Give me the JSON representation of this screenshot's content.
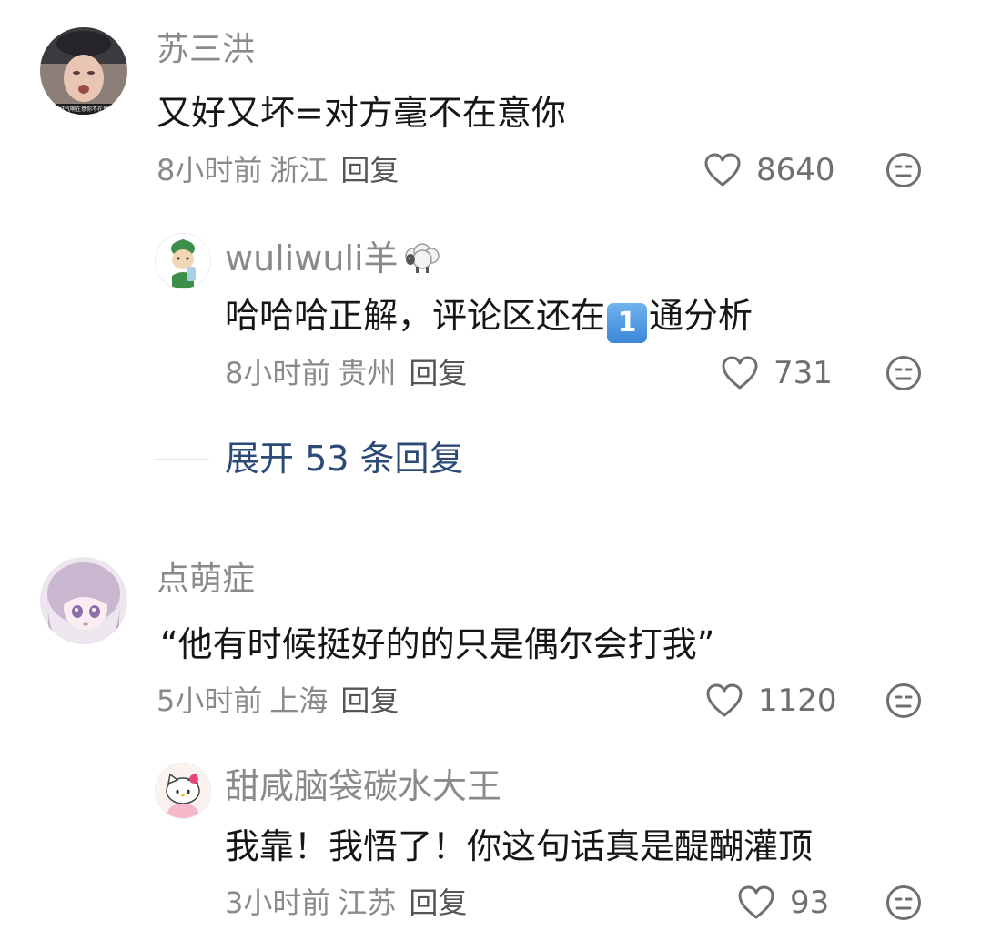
{
  "comments": [
    {
      "username": "苏三洪",
      "text": "又好又坏=对方毫不在意你",
      "time": "8小时前",
      "location": "浙江",
      "reply_label": "回复",
      "likes": "8640",
      "avatar_caption": "我好气啊在意你不在意你",
      "replies": [
        {
          "username": "wuliwuli羊",
          "username_emoji": "sheep",
          "text_before": "哈哈哈正解，评论区还在",
          "text_emoji": "1",
          "text_after": "通分析",
          "time": "8小时前",
          "location": "贵州",
          "reply_label": "回复",
          "likes": "731"
        }
      ],
      "expand_label": "展开 53 条回复"
    },
    {
      "username": "点萌症",
      "text": "“他有时候挺好的的只是偶尔会打我”",
      "time": "5小时前",
      "location": "上海",
      "reply_label": "回复",
      "likes": "1120",
      "replies": [
        {
          "username": "甜咸脑袋碳水大王",
          "text": "我靠！我悟了！你这句话真是醍醐灌顶",
          "time": "3小时前",
          "location": "江苏",
          "reply_label": "回复",
          "likes": "93"
        }
      ]
    }
  ],
  "icons": {
    "like": "heart-outline-icon",
    "dislike": "meh-face-icon"
  },
  "colors": {
    "username": "#8a8a8a",
    "text": "#161616",
    "meta": "#8a8a8a",
    "expand_link": "#2b4a78"
  }
}
